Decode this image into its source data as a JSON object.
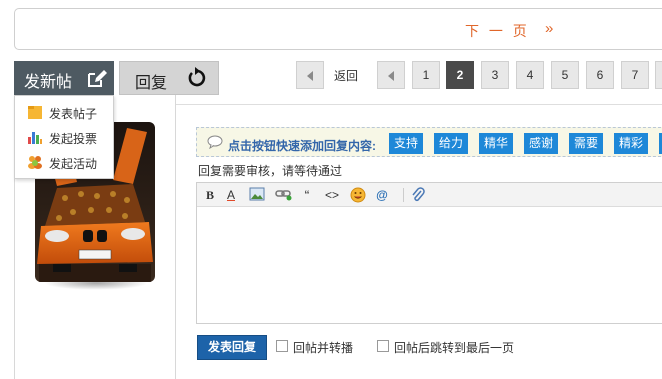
{
  "topbar": {
    "next_page_label": "下 一 页",
    "next_arrow": "»",
    "accent_color": "#e0662a"
  },
  "actions": {
    "new_post_label": "发新帖",
    "new_post_icon": "edit-icon",
    "reply_label": "回复",
    "reply_icon": "undo-icon"
  },
  "new_post_menu": [
    {
      "label": "发表帖子",
      "icon": "folder-icon"
    },
    {
      "label": "发起投票",
      "icon": "poll-chart-icon"
    },
    {
      "label": "发起活动",
      "icon": "people-icon"
    }
  ],
  "pager": {
    "back_label": "返回",
    "pages": [
      "1",
      "2",
      "3",
      "4",
      "5",
      "6",
      "7"
    ],
    "current": "2"
  },
  "quick_reply": {
    "prompt": "点击按钮快速添加回复内容:",
    "buttons": [
      "支持",
      "给力",
      "精华",
      "感谢",
      "需要",
      "精彩"
    ],
    "button_color": "#1e88d8"
  },
  "notice": "回复需要审核，请等待通过",
  "editor": {
    "toolbar": [
      {
        "name": "bold-icon",
        "glyph": "B"
      },
      {
        "name": "font-color-icon",
        "glyph": "A"
      },
      {
        "name": "image-icon",
        "glyph": ""
      },
      {
        "name": "link-icon",
        "glyph": ""
      },
      {
        "name": "quote-icon",
        "glyph": "“"
      },
      {
        "name": "code-icon",
        "glyph": "<>"
      },
      {
        "name": "emoji-icon",
        "glyph": ""
      },
      {
        "name": "at-mention-icon",
        "glyph": "@"
      },
      {
        "name": "attachment-icon",
        "glyph": ""
      }
    ]
  },
  "footer": {
    "submit_label": "发表回复",
    "checkbox_repost": "回帖并转播",
    "checkbox_jump_last": "回帖后跳转到最后一页"
  }
}
